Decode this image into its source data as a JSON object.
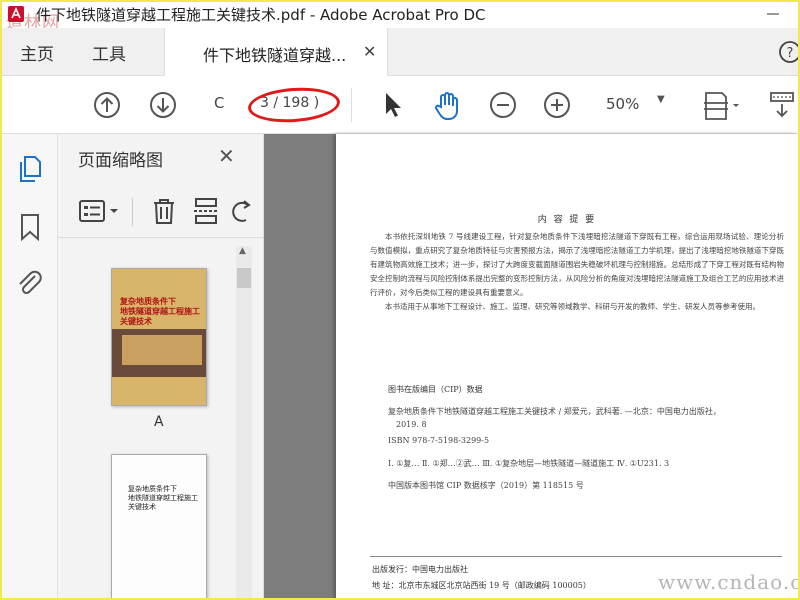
{
  "window": {
    "title": "件下地铁隧道穿越工程施工关键技术.pdf - Adobe Acrobat Pro DC",
    "watermark_top_left": "道林网"
  },
  "tabs": {
    "home": "主页",
    "tools": "工具",
    "document": "件下地铁隧道穿越..."
  },
  "toolbar": {
    "page_prefix": "C",
    "page_display": "3 / 198 )",
    "zoom": "50%"
  },
  "thumbnail_panel": {
    "title": "页面缩略图",
    "thumbnails": [
      {
        "label": "A",
        "title_lines": [
          "复杂地质条件下",
          "地铁隧道穿越工程施工",
          "关键技术"
        ]
      },
      {
        "label": "",
        "title_lines": [
          "复杂地质条件下",
          "地铁隧道穿越工程施工",
          "关键技术"
        ]
      }
    ]
  },
  "document": {
    "heading": "内 容 提 要",
    "para1": "本书依托深圳地铁 7 号线建设工程，针对复杂地质条件下浅埋暗挖法隧道下穿既有工程，综合运用现场试验、理论分析与数值模拟，重点研究了复杂地质特征与灾害预报方法，揭示了浅埋暗挖法隧道工力学机理，提出了浅埋暗挖地铁隧道下穿既有建筑物高效施工技术；进一步，探讨了大跨度变截面隧道围岩失稳破坏机理与控制措施。总结形成了下穿工程对既有结构物安全控制的流程与风险控制体系提出完整的变形控制方法，从风险分析的角度对浅埋暗挖法隧道施工及组合工艺的应用技术进行评价，对今后类似工程的建设具有重要意义。",
    "para2": "本书适用于从事地下工程设计、施工、监理、研究等领域教学、科研与开发的教师、学生、研发人员等参考使用。",
    "cip_title": "图书在版编目（CIP）数据",
    "cip_lines": [
      "复杂地质条件下地铁隧道穿越工程施工关键技术 / 郑爱元，武科著. —北京：中国电力出版社，",
      "2019. 8",
      "ISBN  978-7-5198-3299-5",
      "Ⅰ. ①复…   Ⅱ. ①郑…②武…   Ⅲ. ①复杂地层—地铁隧道—隧道施工   Ⅳ. ①U231. 3",
      "中国版本图书馆 CIP 数据核字（2019）第 118515 号"
    ],
    "publisher_lines": [
      "出版发行：中国电力出版社",
      "地    址：北京市东城区北京站西街 19 号（邮政编码 100005）"
    ],
    "watermark": "www.cndao.com"
  },
  "colors": {
    "accent_blue": "#1a73c8",
    "annotation_red": "#e01a1a",
    "outer_border": "#f2e94e"
  }
}
